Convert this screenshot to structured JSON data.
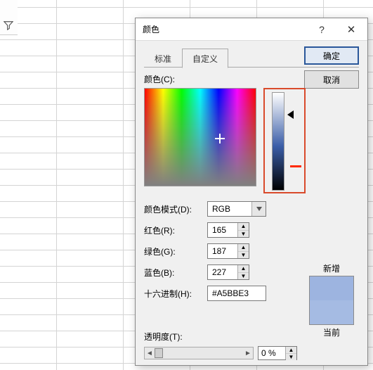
{
  "dialog": {
    "title": "颜色",
    "help_label": "?",
    "close_label": "✕",
    "tabs": {
      "standard": "标准",
      "custom": "自定义"
    },
    "buttons": {
      "ok": "确定",
      "cancel": "取消"
    },
    "color_label": "颜色(C):",
    "mode_label": "颜色模式(D):",
    "mode_value": "RGB",
    "fields": {
      "red_label": "红色(R):",
      "green_label": "绿色(G):",
      "blue_label": "蓝色(B):",
      "hex_label": "十六进制(H):",
      "red": "165",
      "green": "187",
      "blue": "227",
      "hex": "#A5BBE3"
    },
    "transparency_label": "透明度(T):",
    "transparency_value": "0 %",
    "preview": {
      "new_label": "新增",
      "current_label": "当前"
    },
    "colors": {
      "new": "#9db4e0",
      "current": "#a5bbe3"
    }
  }
}
